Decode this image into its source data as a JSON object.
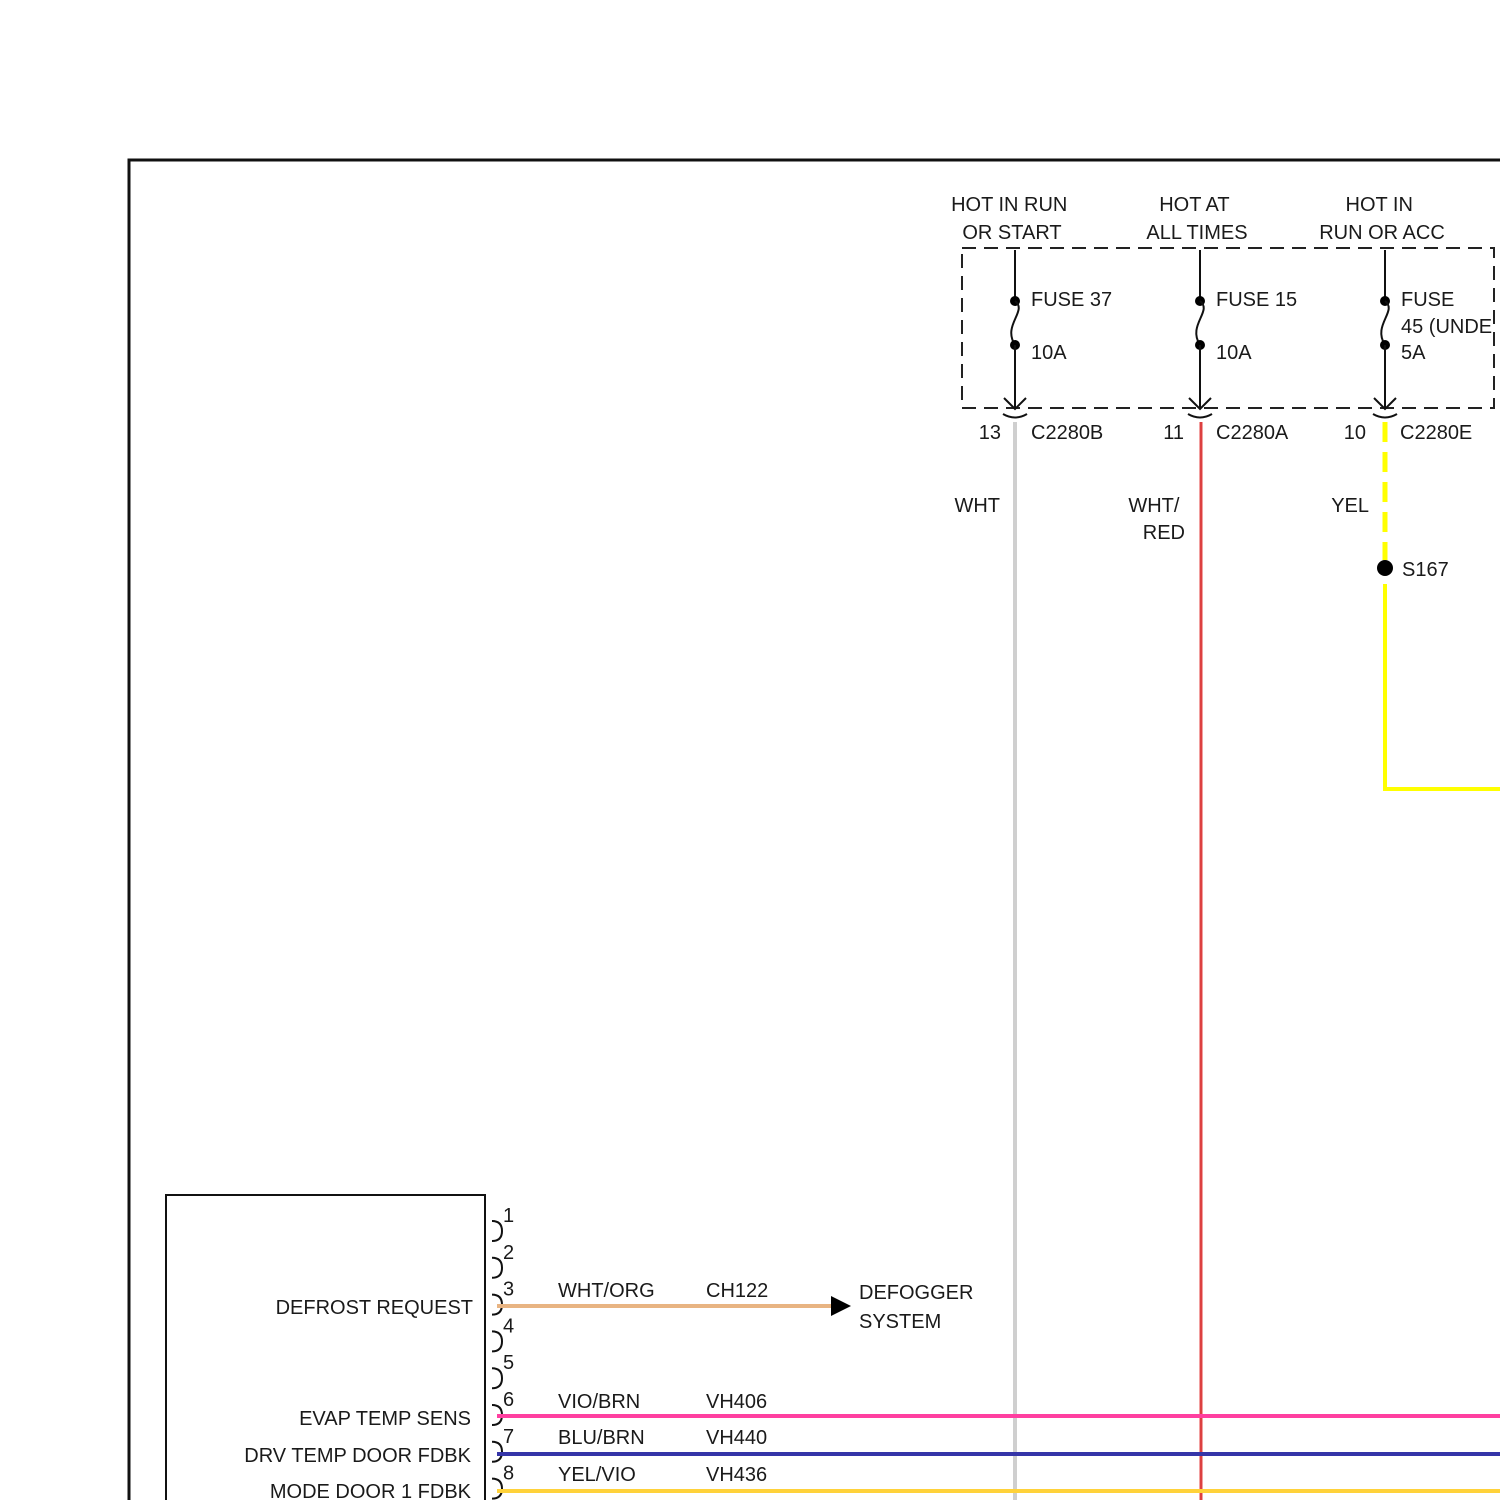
{
  "fuses": [
    {
      "id": "fuse37",
      "supply": "HOT IN RUN\nOR START",
      "name": "FUSE 37",
      "rating": "10A",
      "pin": "13",
      "connector": "C2280B",
      "wire_color_label": "WHT",
      "wire_hex": "#cfcfcf"
    },
    {
      "id": "fuse15",
      "supply": "HOT AT\nALL TIMES",
      "name": "FUSE 15",
      "rating": "10A",
      "pin": "11",
      "connector": "C2280A",
      "wire_color_label": "WHT/\nRED",
      "wire_hex": "#e06060"
    },
    {
      "id": "fuse45",
      "supply": "HOT IN\nRUN OR ACC",
      "name": "FUSE\n45 (UNDE",
      "rating": "5A",
      "pin": "10",
      "connector": "C2280E",
      "wire_color_label": "YEL",
      "wire_hex": "#ffff00"
    }
  ],
  "splice": "S167",
  "module_pins": [
    "1",
    "2",
    "3",
    "4",
    "5",
    "6",
    "7",
    "8"
  ],
  "circuits": [
    {
      "pin": "3",
      "label": "DEFROST REQUEST",
      "wire_color": "WHT/ORG",
      "circuit_id": "CH122",
      "hex": "#e8b482",
      "destination": "DEFOGGER\nSYSTEM"
    },
    {
      "pin": "6",
      "label": "EVAP TEMP SENS",
      "wire_color": "VIO/BRN",
      "circuit_id": "VH406",
      "hex": "#ff3fa0"
    },
    {
      "pin": "7",
      "label": "DRV TEMP DOOR FDBK",
      "wire_color": "BLU/BRN",
      "circuit_id": "VH440",
      "hex": "#3535a8"
    },
    {
      "pin": "8",
      "label": "MODE DOOR 1 FDBK",
      "wire_color": "YEL/VIO",
      "circuit_id": "VH436",
      "hex": "#ffd23a"
    }
  ]
}
